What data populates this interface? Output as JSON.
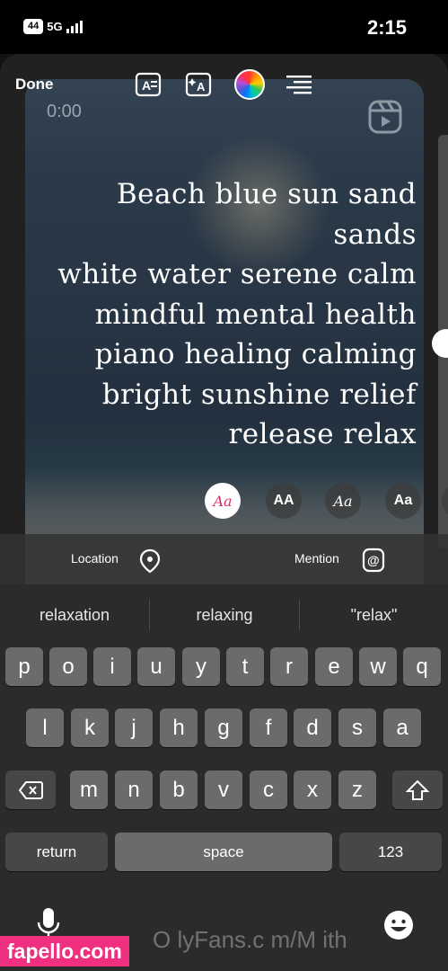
{
  "status_bar": {
    "time": "2:15",
    "network": "5G",
    "battery": "44"
  },
  "editor": {
    "done_label": "Done",
    "timer": "0:00",
    "caption_lines": [
      "Beach blue sun sand sands",
      "white water serene calm",
      "mindful mental health",
      "piano healing calming",
      "bright sunshine relief",
      "release relax"
    ],
    "font_styles": [
      "Aa",
      "Aa",
      "AA",
      "Aa",
      "Aa"
    ],
    "text_size_level": 0.5
  },
  "sticker_bar": {
    "mention_label": "Mention",
    "location_label": "Location"
  },
  "keyboard": {
    "suggestions": [
      "\"relax\"",
      "relaxing",
      "relaxation"
    ],
    "row1": [
      "q",
      "w",
      "e",
      "r",
      "t",
      "y",
      "u",
      "i",
      "o",
      "p"
    ],
    "row2": [
      "a",
      "s",
      "d",
      "f",
      "g",
      "h",
      "j",
      "k",
      "l"
    ],
    "row3": [
      "z",
      "x",
      "c",
      "v",
      "b",
      "n",
      "m"
    ],
    "numbers_label": "123",
    "space_label": "space",
    "return_label": "return"
  },
  "watermark": {
    "site": "fapello.com",
    "text": "O lyFans.c m/M ith"
  },
  "colors": {
    "accent": "#ef2f7f",
    "keyboard_bg": "#2b2b2b",
    "key": "#6b6b6b"
  }
}
